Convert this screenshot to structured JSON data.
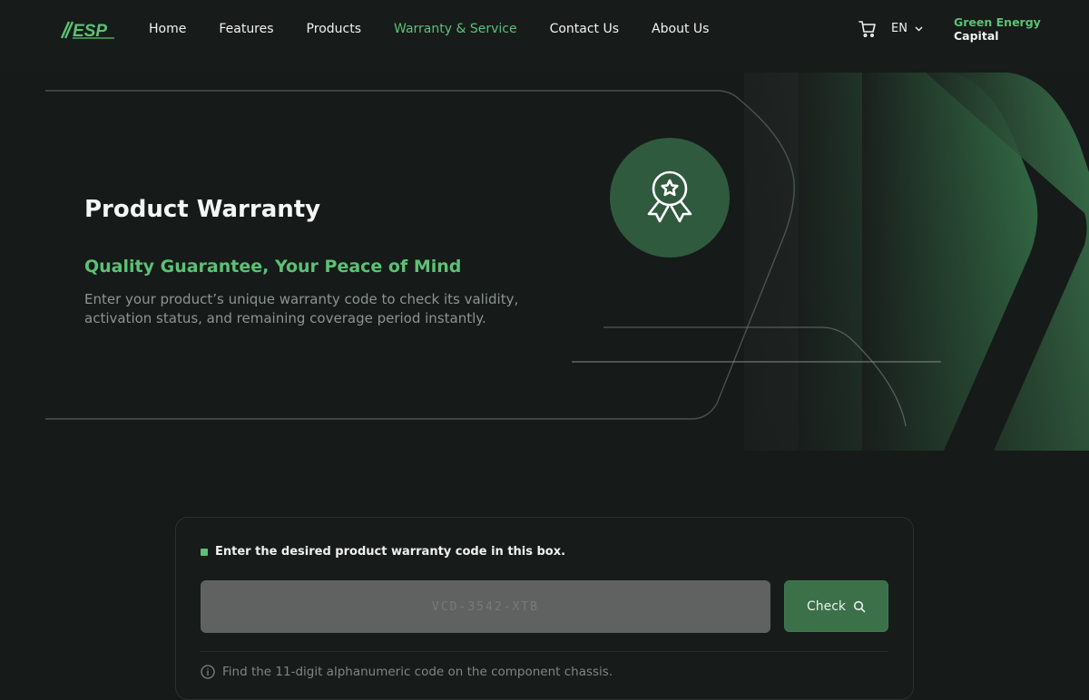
{
  "nav": {
    "logo_text": "ESP",
    "links": [
      {
        "label": "Home",
        "active": false
      },
      {
        "label": "Features",
        "active": false
      },
      {
        "label": "Products",
        "active": false
      },
      {
        "label": "Warranty & Service",
        "active": true
      },
      {
        "label": "Contact Us",
        "active": false
      },
      {
        "label": "About Us",
        "active": false
      }
    ],
    "language": "EN",
    "brand_line1": "Green Energy",
    "brand_line2": "Capital"
  },
  "hero": {
    "title": "Product Warranty",
    "subtitle": "Quality Guarantee, Your Peace of Mind",
    "description": "Enter your product’s unique warranty code to check its validity, activation status, and remaining coverage period instantly."
  },
  "warranty_form": {
    "label": "Enter the desired product warranty code in this box.",
    "input_value": "",
    "input_placeholder": "VCD-3542-XTB",
    "check_label": "Check",
    "hint": "Find the 11-digit alphanumeric code on the component chassis."
  },
  "colors": {
    "accent": "#5cc175",
    "background": "#161a19",
    "button": "#3b7049",
    "badge": "#2f5a3e",
    "input": "#5f6261"
  },
  "icons": [
    "logo-icon",
    "cart-icon",
    "chevron-down-icon",
    "award-ribbon-icon",
    "search-icon",
    "info-icon"
  ]
}
